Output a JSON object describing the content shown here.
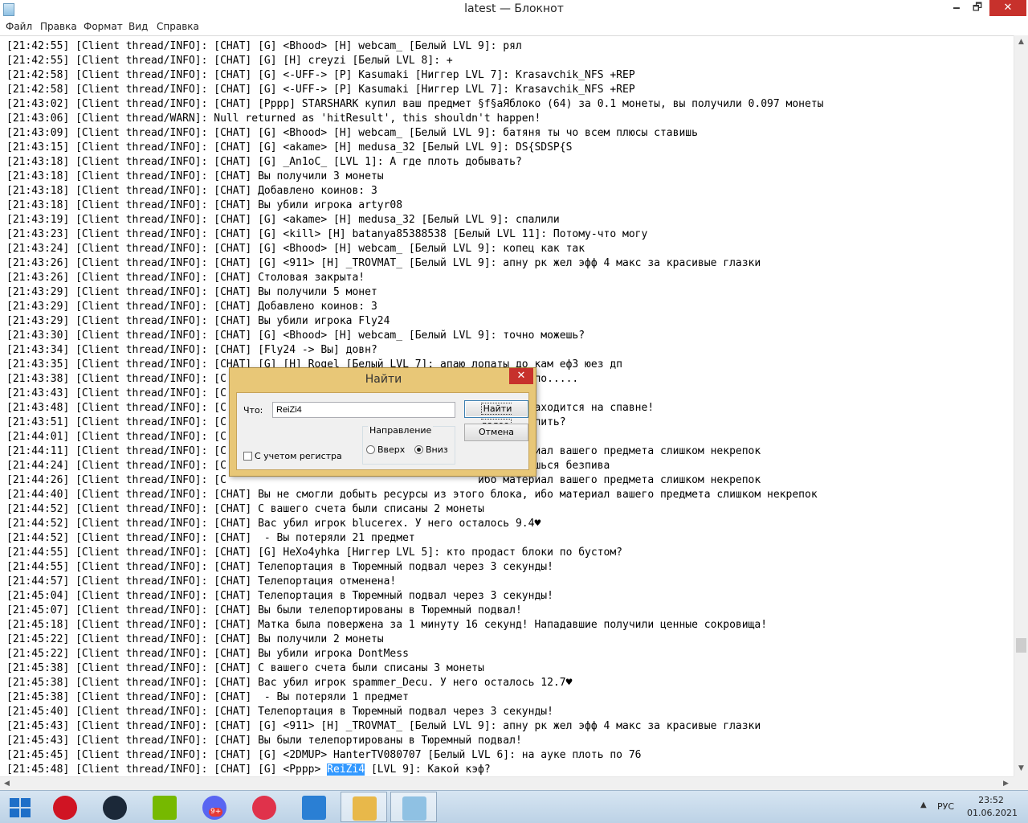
{
  "window": {
    "title": "latest — Блокнот",
    "buttons": {
      "minimize": "🗕",
      "maximize": "🗗",
      "close": "✕"
    }
  },
  "menu": [
    "Файл",
    "Правка",
    "Формат",
    "Вид",
    "Справка"
  ],
  "log_lines": [
    "[21:42:55] [Client thread/INFO]: [CHAT] [G] <Bhood> [H] webcam_ [Белый LVL 9]: рял",
    "[21:42:55] [Client thread/INFO]: [CHAT] [G] [H] creyzi [Белый LVL 8]: +",
    "[21:42:58] [Client thread/INFO]: [CHAT] [G] <-UFF-> [P] Kasumaki [Ниггер LVL 7]: Krasavchik_NFS +REP",
    "[21:42:58] [Client thread/INFO]: [CHAT] [G] <-UFF-> [P] Kasumaki [Ниггер LVL 7]: Krasavchik_NFS +REP",
    "[21:43:02] [Client thread/INFO]: [CHAT] [Pppp] STARSHARK купил ваш предмет §f§aЯблоко (64) за 0.1 монеты, вы получили 0.097 монеты",
    "[21:43:06] [Client thread/WARN]: Null returned as 'hitResult', this shouldn't happen!",
    "[21:43:09] [Client thread/INFO]: [CHAT] [G] <Bhood> [H] webcam_ [Белый LVL 9]: батяня ты чо всем плюсы ставишь",
    "[21:43:15] [Client thread/INFO]: [CHAT] [G] <akame> [H] medusa_32 [Белый LVL 9]: DS{SDSP{S",
    "[21:43:18] [Client thread/INFO]: [CHAT] [G] _An1oC_ [LVL 1]: А где плоть добывать?",
    "[21:43:18] [Client thread/INFO]: [CHAT] Вы получили 3 монеты",
    "[21:43:18] [Client thread/INFO]: [CHAT] Добавлено коинов: 3",
    "[21:43:18] [Client thread/INFO]: [CHAT] Вы убили игрока artyr08",
    "[21:43:19] [Client thread/INFO]: [CHAT] [G] <akame> [H] medusa_32 [Белый LVL 9]: спалили",
    "[21:43:23] [Client thread/INFO]: [CHAT] [G] <kill> [H] batanya85388538 [Белый LVL 11]: Потому-что могу",
    "[21:43:24] [Client thread/INFO]: [CHAT] [G] <Bhood> [H] webcam_ [Белый LVL 9]: копец как так",
    "[21:43:26] [Client thread/INFO]: [CHAT] [G] <911> [H] _TROVMAT_ [Белый LVL 9]: апну рк жел эфф 4 макс за красивые глазки",
    "[21:43:26] [Client thread/INFO]: [CHAT] Столовая закрыта!",
    "[21:43:29] [Client thread/INFO]: [CHAT] Вы получили 5 монет",
    "[21:43:29] [Client thread/INFO]: [CHAT] Добавлено коинов: 3",
    "[21:43:29] [Client thread/INFO]: [CHAT] Вы убили игрока Fly24",
    "[21:43:30] [Client thread/INFO]: [CHAT] [G] <Bhood> [H] webcam_ [Белый LVL 9]: точно можешь?",
    "[21:43:34] [Client thread/INFO]: [CHAT] [Fly24 -> Вы] довн?",
    "[21:43:35] [Client thread/INFO]: [CHAT] [G] [H] Rogel [Белый LVL 7]: апаю лопаты до кам еф3 юез дп",
    "[21:43:38] [Client thread/INFO]: [C                                        1]: Ну типо.....",
    "[21:43:43] [Client thread/INFO]: [C                                        о....",
    "[21:43:48] [Client thread/INFO]: [C                                        которая находится на спавне!",
    "[21:43:51] [Client thread/INFO]: [C                                        во когда пить?",
    "[21:44:01] [Client thread/INFO]: [C",
    "[21:44:11] [Client thread/INFO]: [C                                        ибо материал вашего предмета слишком некрепок",
    "[21:44:24] [Client thread/INFO]: [C                                        ит останешься безпива",
    "[21:44:26] [Client thread/INFO]: [C                                        ибо материал вашего предмета слишком некрепок",
    "[21:44:40] [Client thread/INFO]: [CHAT] Вы не смогли добыть ресурсы из этого блока, ибо материал вашего предмета слишком некрепок",
    "[21:44:52] [Client thread/INFO]: [CHAT] С вашего счета были списаны 2 монеты",
    "[21:44:52] [Client thread/INFO]: [CHAT] Вас убил игрок blucerex. У него осталось 9.4♥",
    "[21:44:52] [Client thread/INFO]: [CHAT]  - Вы потеряли 21 предмет",
    "[21:44:55] [Client thread/INFO]: [CHAT] [G] HeXo4yhka [Ниггер LVL 5]: кто продаст блоки по бустом?",
    "[21:44:55] [Client thread/INFO]: [CHAT] Телепортация в Тюремный подвал через 3 секунды!",
    "[21:44:57] [Client thread/INFO]: [CHAT] Телепортация отменена!",
    "[21:45:04] [Client thread/INFO]: [CHAT] Телепортация в Тюремный подвал через 3 секунды!",
    "[21:45:07] [Client thread/INFO]: [CHAT] Вы были телепортированы в Тюремный подвал!",
    "[21:45:18] [Client thread/INFO]: [CHAT] Матка была повержена за 1 минуту 16 секунд! Нападавшие получили ценные сокровища!",
    "[21:45:22] [Client thread/INFO]: [CHAT] Вы получили 2 монеты",
    "[21:45:22] [Client thread/INFO]: [CHAT] Вы убили игрока DontMess",
    "[21:45:38] [Client thread/INFO]: [CHAT] С вашего счета были списаны 3 монеты",
    "[21:45:38] [Client thread/INFO]: [CHAT] Вас убил игрок spammer_Decu. У него осталось 12.7♥",
    "[21:45:38] [Client thread/INFO]: [CHAT]  - Вы потеряли 1 предмет",
    "[21:45:40] [Client thread/INFO]: [CHAT] Телепортация в Тюремный подвал через 3 секунды!",
    "[21:45:43] [Client thread/INFO]: [CHAT] [G] <911> [H] _TROVMAT_ [Белый LVL 9]: апну рк жел эфф 4 макс за красивые глазки",
    "[21:45:43] [Client thread/INFO]: [CHAT] Вы были телепортированы в Тюремный подвал!",
    "[21:45:45] [Client thread/INFO]: [CHAT] [G] <2DMUP> HanterTV080707 [Белый LVL 6]: на ауке плоть по 76"
  ],
  "last_line": {
    "before": "[21:45:48] [Client thread/INFO]: [CHAT] [G] <Pppp> ",
    "highlight": "ReiZi4",
    "after": " [LVL 9]: Какой кэф?"
  },
  "find_dialog": {
    "title": "Найти",
    "close": "✕",
    "what_label": "Что:",
    "search_value": "ReiZi4",
    "find_next": "Найти далее",
    "cancel": "Отмена",
    "direction_label": "Направление",
    "up": "Вверх",
    "down": "Вниз",
    "direction_selected": "down",
    "match_case": "С учетом регистра",
    "match_case_checked": false
  },
  "taskbar": {
    "apps": [
      {
        "name": "opera",
        "color": "#d01423"
      },
      {
        "name": "steam",
        "color": "#1b2838"
      },
      {
        "name": "nvidia",
        "color": "#76b900"
      },
      {
        "name": "discord",
        "color": "#5865f2",
        "badge": "9+"
      },
      {
        "name": "opera-gx",
        "color": "#e0324b"
      },
      {
        "name": "app-shield",
        "color": "#2a7fd4"
      },
      {
        "name": "file-explorer",
        "color": "#e8b84a"
      },
      {
        "name": "notepad",
        "color": "#8fc1e3"
      }
    ],
    "language": "РУС",
    "time": "23:52",
    "date": "01.06.2021"
  },
  "scroll": {
    "up": "▲",
    "down": "▼",
    "left": "◀",
    "right": "▶"
  }
}
